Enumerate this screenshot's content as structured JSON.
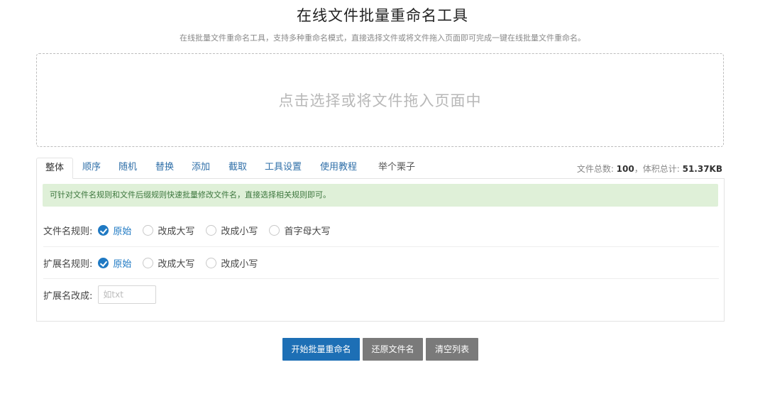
{
  "header": {
    "title": "在线文件批量重命名工具",
    "subtitle": "在线批量文件重命名工具，支持多种重命名模式，直接选择文件或将文件拖入页面即可完成一键在线批量文件重命名。"
  },
  "dropzone": {
    "text": "点击选择或将文件拖入页面中"
  },
  "tabs": [
    {
      "label": "整体"
    },
    {
      "label": "顺序"
    },
    {
      "label": "随机"
    },
    {
      "label": "替换"
    },
    {
      "label": "添加"
    },
    {
      "label": "截取"
    },
    {
      "label": "工具设置"
    },
    {
      "label": "使用教程"
    },
    {
      "label": "举个栗子"
    }
  ],
  "stats": {
    "count_label": "文件总数: ",
    "count_value": "100",
    "size_label": "，体积总计: ",
    "size_value": "51.37KB"
  },
  "panel": {
    "notice": "可针对文件名规则和文件后缀规则快速批量修改文件名，直接选择相关规则即可。",
    "filename_rule": {
      "label": "文件名规则:",
      "options": [
        "原始",
        "改成大写",
        "改成小写",
        "首字母大写"
      ],
      "selected": "原始"
    },
    "ext_rule": {
      "label": "扩展名规则:",
      "options": [
        "原始",
        "改成大写",
        "改成小写"
      ],
      "selected": "原始"
    },
    "ext_change": {
      "label": "扩展名改成:",
      "placeholder": "如txt",
      "value": ""
    }
  },
  "actions": {
    "start": "开始批量重命名",
    "restore": "还原文件名",
    "clear": "清空列表"
  },
  "colors": {
    "primary": "#1d6fb5",
    "secondary_button": "#7a7a7a",
    "notice_bg": "#dff0d8",
    "link": "#2f6fa8"
  }
}
